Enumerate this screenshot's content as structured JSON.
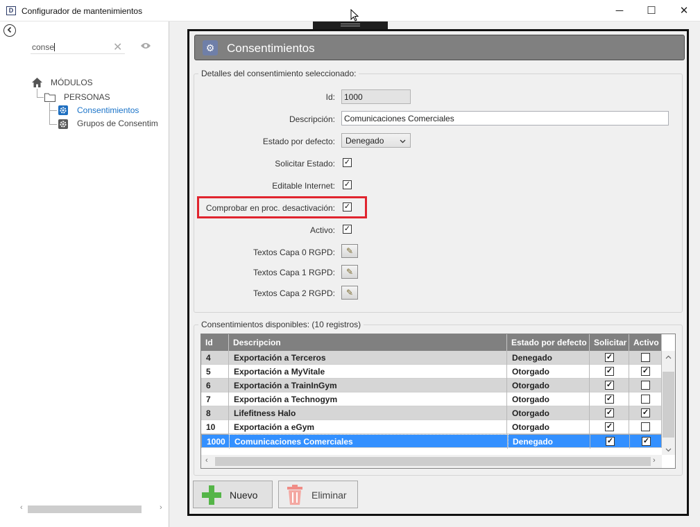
{
  "window": {
    "app_icon": "D",
    "title": "Configurador de mantenimientos",
    "minimize_icon": "─",
    "maximize_icon": "☐",
    "close_icon": "✕"
  },
  "sidebar": {
    "back_icon": "arrow-left-icon",
    "search": {
      "value": "conse",
      "clear_icon": "✕",
      "eye_icon": "👁"
    },
    "tree": {
      "root": "MÓDULOS",
      "folder": "PERSONAS",
      "items": [
        "Consentimientos",
        "Grupos de Consentim"
      ]
    }
  },
  "panel": {
    "title": "Consentimientos",
    "details": {
      "group_title": "Detalles del consentimiento seleccionado:",
      "id_label": "Id:",
      "id_value": "1000",
      "descripcion_label": "Descripción:",
      "descripcion_value": "Comunicaciones Comerciales",
      "estado_label": "Estado por defecto:",
      "estado_value": "Denegado",
      "solicitar_label": "Solicitar Estado:",
      "editable_label": "Editable Internet:",
      "comprobar_label": "Comprobar en proc. desactivación:",
      "activo_label": "Activo:",
      "textos0_label": "Textos Capa 0 RGPD:",
      "textos1_label": "Textos Capa 1 RGPD:",
      "textos2_label": "Textos Capa 2 RGPD:",
      "check_mark": "✓",
      "pencil_icon": "✎"
    },
    "list": {
      "group_title": "Consentimientos disponibles:  (10 registros)",
      "columns": [
        "Id",
        "Descripcion",
        "Estado por defecto",
        "Solicitar",
        "Activo"
      ],
      "rows": [
        {
          "id": "4",
          "descripcion": "Exportación a Terceros",
          "estado": "Denegado",
          "solicitar": true,
          "activo": false
        },
        {
          "id": "5",
          "descripcion": "Exportación a MyVitale",
          "estado": "Otorgado",
          "solicitar": true,
          "activo": true
        },
        {
          "id": "6",
          "descripcion": "Exportación a TrainInGym",
          "estado": "Otorgado",
          "solicitar": true,
          "activo": false
        },
        {
          "id": "7",
          "descripcion": "Exportación a Technogym",
          "estado": "Otorgado",
          "solicitar": true,
          "activo": false
        },
        {
          "id": "8",
          "descripcion": "Lifefitness Halo",
          "estado": "Otorgado",
          "solicitar": true,
          "activo": true
        },
        {
          "id": "10",
          "descripcion": "Exportación a eGym",
          "estado": "Otorgado",
          "solicitar": true,
          "activo": false
        },
        {
          "id": "1000",
          "descripcion": "Comunicaciones Comerciales",
          "estado": "Denegado",
          "solicitar": true,
          "activo": true
        }
      ],
      "selected_index": 6
    },
    "buttons": {
      "nuevo": "Nuevo",
      "eliminar": "Eliminar"
    }
  },
  "colors": {
    "selection": "#3390ff",
    "highlight": "#e0242e",
    "header": "#808080",
    "link": "#1a73c8"
  }
}
